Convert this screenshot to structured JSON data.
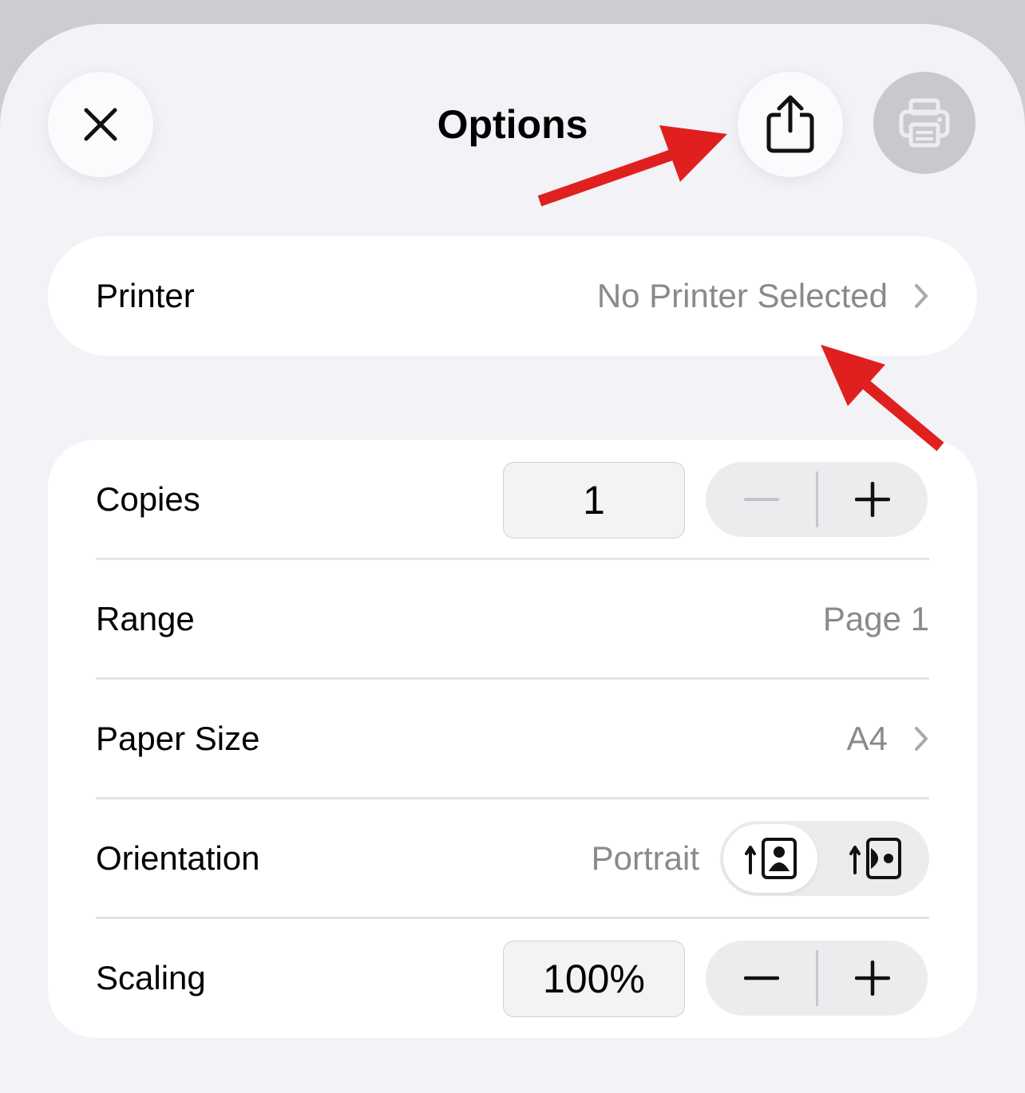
{
  "header": {
    "title": "Options",
    "close_icon": "close-icon",
    "share_icon": "share-icon",
    "print_icon": "printer-icon"
  },
  "printer": {
    "label": "Printer",
    "value": "No Printer Selected"
  },
  "copies": {
    "label": "Copies",
    "value": "1",
    "decrement_enabled": false
  },
  "range": {
    "label": "Range",
    "value": "Page 1"
  },
  "paper_size": {
    "label": "Paper Size",
    "value": "A4"
  },
  "orientation": {
    "label": "Orientation",
    "value": "Portrait",
    "options": [
      "portrait-icon",
      "landscape-icon"
    ],
    "selected": "portrait"
  },
  "scaling": {
    "label": "Scaling",
    "value": "100%"
  },
  "colors": {
    "annotation_arrow": "#e0201f",
    "secondary_text": "#8a8a8e"
  }
}
